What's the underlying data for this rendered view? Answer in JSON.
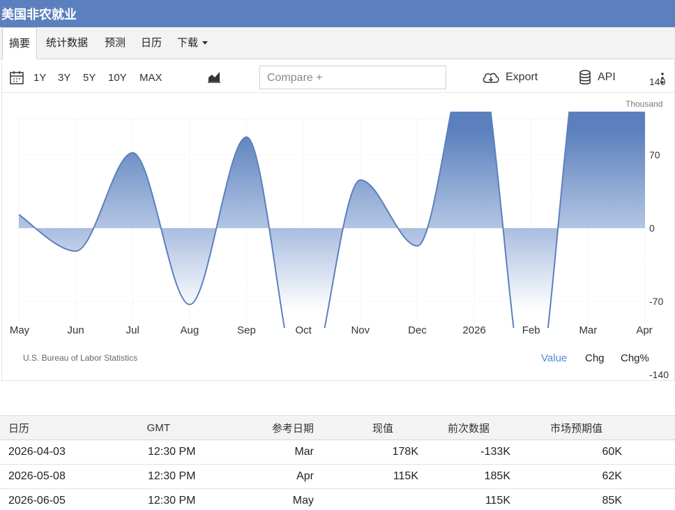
{
  "header": {
    "title": "美国非农就业"
  },
  "tabs": [
    {
      "label": "摘要"
    },
    {
      "label": "统计数据"
    },
    {
      "label": "预测"
    },
    {
      "label": "日历"
    },
    {
      "label": "下载"
    }
  ],
  "toolbar": {
    "ranges": [
      "1Y",
      "3Y",
      "5Y",
      "10Y",
      "MAX"
    ],
    "compare_placeholder": "Compare +",
    "export_label": "Export",
    "api_label": "API"
  },
  "chart_data": {
    "type": "area",
    "unit": "Thousand",
    "x": [
      "May",
      "Jun",
      "Jul",
      "Aug",
      "Sep",
      "Oct",
      "Nov",
      "Dec",
      "2026",
      "Feb",
      "Mar",
      "Apr"
    ],
    "values": [
      13,
      -22,
      72,
      -73,
      87,
      -160,
      46,
      -17,
      185,
      -178,
      212,
      130
    ],
    "ylim": [
      -180,
      240
    ],
    "yticks": [
      140,
      70,
      0,
      -70,
      -140
    ],
    "grid": true,
    "source": "U.S. Bureau of Labor Statistics",
    "modes": [
      "Value",
      "Chg",
      "Chg%"
    ],
    "active_mode": "Value",
    "colors": {
      "line": "#5b80bd",
      "fill_top": "#5b80bd",
      "fill_bottom": "#ffffff"
    }
  },
  "calendar": {
    "headers": [
      "日历",
      "GMT",
      "参考日期",
      "现值",
      "前次数据",
      "市场预期值"
    ],
    "rows": [
      [
        "2026-04-03",
        "12:30 PM",
        "Mar",
        "178K",
        "-133K",
        "60K"
      ],
      [
        "2026-05-08",
        "12:30 PM",
        "Apr",
        "115K",
        "185K",
        "62K"
      ],
      [
        "2026-06-05",
        "12:30 PM",
        "May",
        "",
        "115K",
        "85K"
      ]
    ]
  }
}
